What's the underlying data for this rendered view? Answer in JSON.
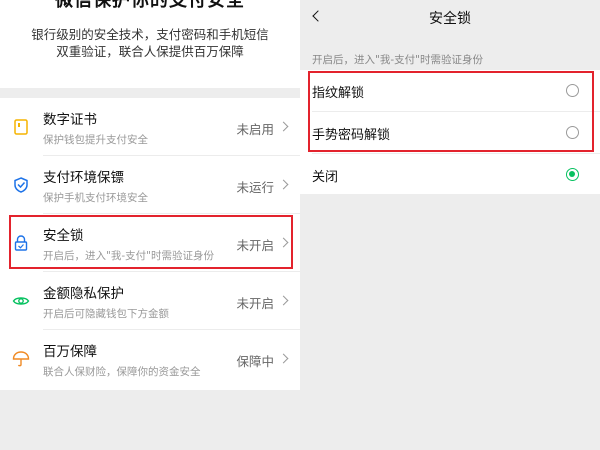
{
  "left_panel": {
    "hero": {
      "title": "微信保护你的支付安全",
      "desc_line1": "银行级别的安全技术，支付密码和手机短信",
      "desc_line2": "双重验证，联合人保提供百万保障"
    },
    "items": [
      {
        "icon": "certificate-icon",
        "title": "数字证书",
        "sub": "保护钱包提升支付安全",
        "status": "未启用"
      },
      {
        "icon": "shield-check-icon",
        "title": "支付环境保镖",
        "sub": "保护手机支付环境安全",
        "status": "未运行"
      },
      {
        "icon": "lock-icon",
        "title": "安全锁",
        "sub": "开启后，进入\"我-支付\"时需验证身份",
        "status": "未开启"
      },
      {
        "icon": "eye-icon",
        "title": "金额隐私保护",
        "sub": "开启后可隐藏钱包下方金额",
        "status": "未开启"
      },
      {
        "icon": "umbrella-icon",
        "title": "百万保障",
        "sub": "联合人保财险，保障你的资金安全",
        "status": "保障中"
      }
    ]
  },
  "right_panel": {
    "nav_title": "安全锁",
    "hint": "开启后，进入\"我-支付\"时需验证身份",
    "options": [
      {
        "label": "指纹解锁",
        "selected": false
      },
      {
        "label": "手势密码解锁",
        "selected": false
      },
      {
        "label": "关闭",
        "selected": true
      }
    ]
  },
  "colors": {
    "accent_green": "#07c160",
    "highlight_red": "#e3232d",
    "icon_yellow": "#f5b400",
    "icon_blue": "#1e73e8",
    "icon_orange": "#f08a24"
  }
}
